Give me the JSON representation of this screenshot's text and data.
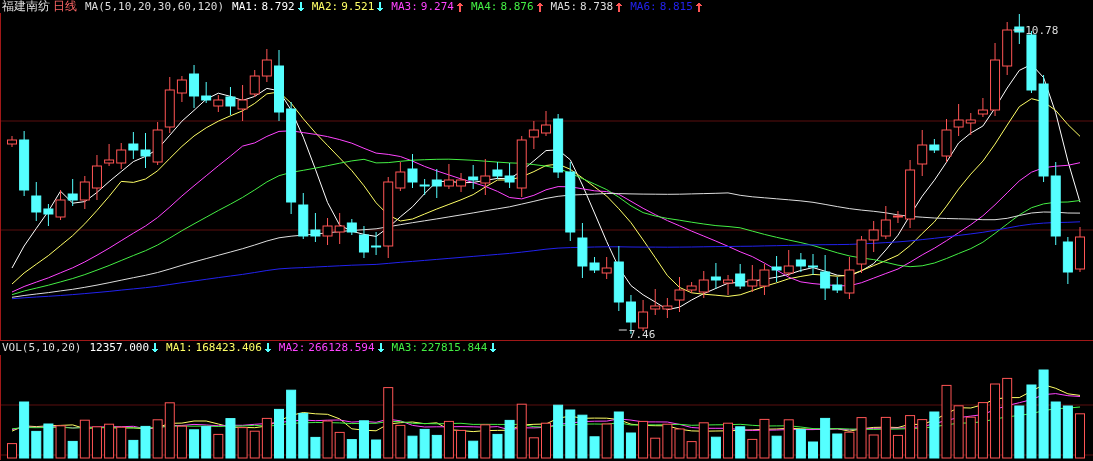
{
  "header": {
    "stock_name": "福建南纺",
    "period": "日线",
    "indicator": "MA(5,10,20,30,60,120)",
    "ma_lines": [
      {
        "label": "MA1:",
        "value": "8.792",
        "arrow": {
          "kind": "down",
          "color": "#55ffff"
        },
        "color": "#ffffff"
      },
      {
        "label": "MA2:",
        "value": "9.521",
        "arrow": {
          "kind": "down",
          "color": "#55ffff"
        },
        "color": "#ffff66"
      },
      {
        "label": "MA3:",
        "value": "9.274",
        "arrow": {
          "kind": "up",
          "color": "#ff5555"
        },
        "color": "#ff44ff"
      },
      {
        "label": "MA4:",
        "value": "8.876",
        "arrow": {
          "kind": "up",
          "color": "#ff5555"
        },
        "color": "#44ee44"
      },
      {
        "label": "MA5:",
        "value": "8.738",
        "arrow": {
          "kind": "up",
          "color": "#ff5555"
        },
        "color": "#dddddd"
      },
      {
        "label": "MA6:",
        "value": "8.815",
        "arrow": {
          "kind": "up",
          "color": "#ff5555"
        },
        "color": "#2222ee"
      }
    ]
  },
  "price_chart": {
    "high_label": "10.78",
    "low_label": "7.46"
  },
  "volume": {
    "indicator": "VOL(5,10,20)",
    "value": "12357.000",
    "arrow": {
      "kind": "down",
      "color": "#55ffff"
    },
    "ma_lines": [
      {
        "label": "MA1:",
        "value": "168423.406",
        "arrow": {
          "kind": "down",
          "color": "#55ffff"
        },
        "color": "#ffff66"
      },
      {
        "label": "MA2:",
        "value": "266128.594",
        "arrow": {
          "kind": "down",
          "color": "#55ffff"
        },
        "color": "#ff44ff"
      },
      {
        "label": "MA3:",
        "value": "227815.844",
        "arrow": {
          "kind": "down",
          "color": "#55ffff"
        },
        "color": "#44ee44"
      }
    ]
  }
}
